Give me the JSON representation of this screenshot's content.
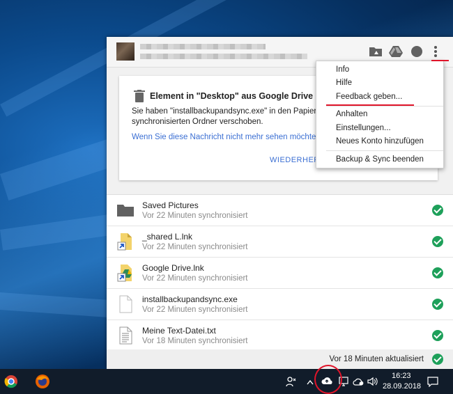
{
  "notice": {
    "title": "Element in \"Desktop\" aus Google Drive entfernt",
    "body": "Sie haben \"installbackupandsync.exe\" in den Papierkorb verschoben oder aus dem synchronisierten Ordner verschoben.",
    "link": "Wenn Sie diese Nachricht nicht mehr sehen möchten, a",
    "restore_label": "WIEDERHERS"
  },
  "files": [
    {
      "name": "Saved Pictures",
      "status": "Vor 22 Minuten synchronisiert",
      "icon": "folder-icon"
    },
    {
      "name": "_shared L.lnk",
      "status": "Vor 22 Minuten synchronisiert",
      "icon": "shortcut-file-icon"
    },
    {
      "name": "Google Drive.lnk",
      "status": "Vor 22 Minuten synchronisiert",
      "icon": "drive-shortcut-icon"
    },
    {
      "name": "installbackupandsync.exe",
      "status": "Vor 22 Minuten synchronisiert",
      "icon": "file-icon"
    },
    {
      "name": "Meine Text-Datei.txt",
      "status": "Vor 18 Minuten synchronisiert",
      "icon": "text-file-icon"
    }
  ],
  "footer": {
    "status": "Vor 18 Minuten aktualisiert"
  },
  "menu": {
    "items": [
      "Info",
      "Hilfe",
      "Feedback geben...",
      "Anhalten",
      "Einstellungen...",
      "Neues Konto hinzufügen",
      "Backup & Sync beenden"
    ]
  },
  "taskbar": {
    "time": "16:23",
    "date": "28.09.2018"
  },
  "colors": {
    "accent": "#3b78e7",
    "check": "#1ea05a",
    "annotation": "#e0142a"
  }
}
